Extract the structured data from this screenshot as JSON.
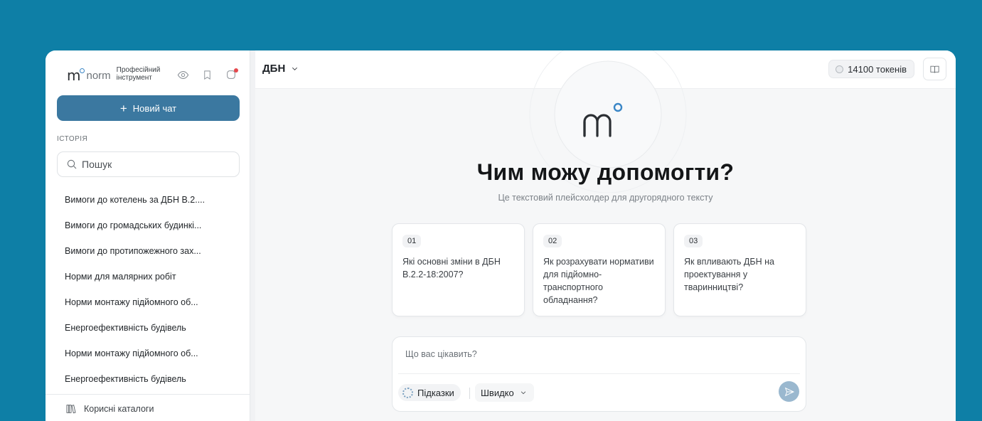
{
  "sidebar": {
    "logo_text": "norm",
    "tagline": "Професійний інструмент",
    "new_chat_label": "Новий чат",
    "history_label": "ІСТОРІЯ",
    "search_placeholder": "Пошук",
    "history": [
      "Вимоги до котелень за ДБН В.2....",
      "Вимоги до громадських будинкі...",
      "Вимоги до протипожежного зах...",
      "Норми для малярних робіт",
      "Норми монтажу підйомного об...",
      "Енергоефективність будівель",
      "Норми монтажу підйомного об...",
      "Енергоефективність будівель"
    ],
    "footer_label": "Корисні каталоги"
  },
  "topbar": {
    "selector_label": "ДБН",
    "tokens_label": "14100 токенів"
  },
  "main": {
    "headline": "Чим можу допомогти?",
    "subtext": "Це текстовий плейсхолдер для другорядного тексту",
    "cards": [
      {
        "num": "01",
        "text": "Які основні зміни в ДБН В.2.2-18:2007?"
      },
      {
        "num": "02",
        "text": "Як розрахувати нормативи для підйомно-транспортного обладнання?"
      },
      {
        "num": "03",
        "text": "Як впливають ДБН на проектування у тваринництві?"
      }
    ]
  },
  "composer": {
    "placeholder": "Що вас цікавить?",
    "hints_label": "Підказки",
    "mode_label": "Швидко"
  },
  "colors": {
    "background": "#0e7fa6",
    "accent": "#3b78a0",
    "logo_dot": "#3a86c6",
    "notification": "#e5484d"
  }
}
